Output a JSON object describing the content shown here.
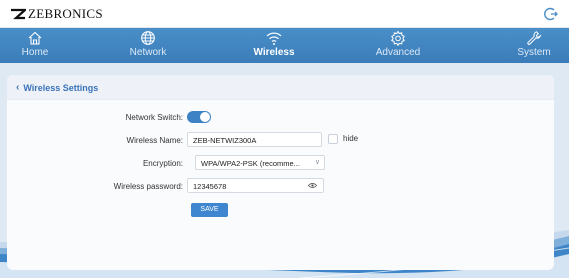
{
  "brand": {
    "name": "ZEBRONICS"
  },
  "header": {
    "logout_icon": "logout-icon"
  },
  "nav": {
    "items": [
      {
        "label": "Home",
        "icon": "home-icon"
      },
      {
        "label": "Network",
        "icon": "globe-icon"
      },
      {
        "label": "Wireless",
        "icon": "wifi-icon",
        "active": true
      },
      {
        "label": "Advanced",
        "icon": "gear-icon"
      },
      {
        "label": "System",
        "icon": "wrench-icon"
      }
    ]
  },
  "panel": {
    "title": "Wireless Settings",
    "network_switch": {
      "label": "Network Switch:",
      "on": true
    },
    "wireless_name": {
      "label": "Wireless Name:",
      "value": "ZEB-NETWIZ300A",
      "hide_label": "hide",
      "hide_checked": false
    },
    "encryption": {
      "label": "Encryption:",
      "value": "WPA/WPA2-PSK (recomme..."
    },
    "password": {
      "label": "Wireless password:",
      "value": "12345678"
    },
    "save_label": "SAVE"
  },
  "colors": {
    "nav": "#3a7cb9",
    "accent": "#3e82c6",
    "panel": "#fafbfd"
  }
}
